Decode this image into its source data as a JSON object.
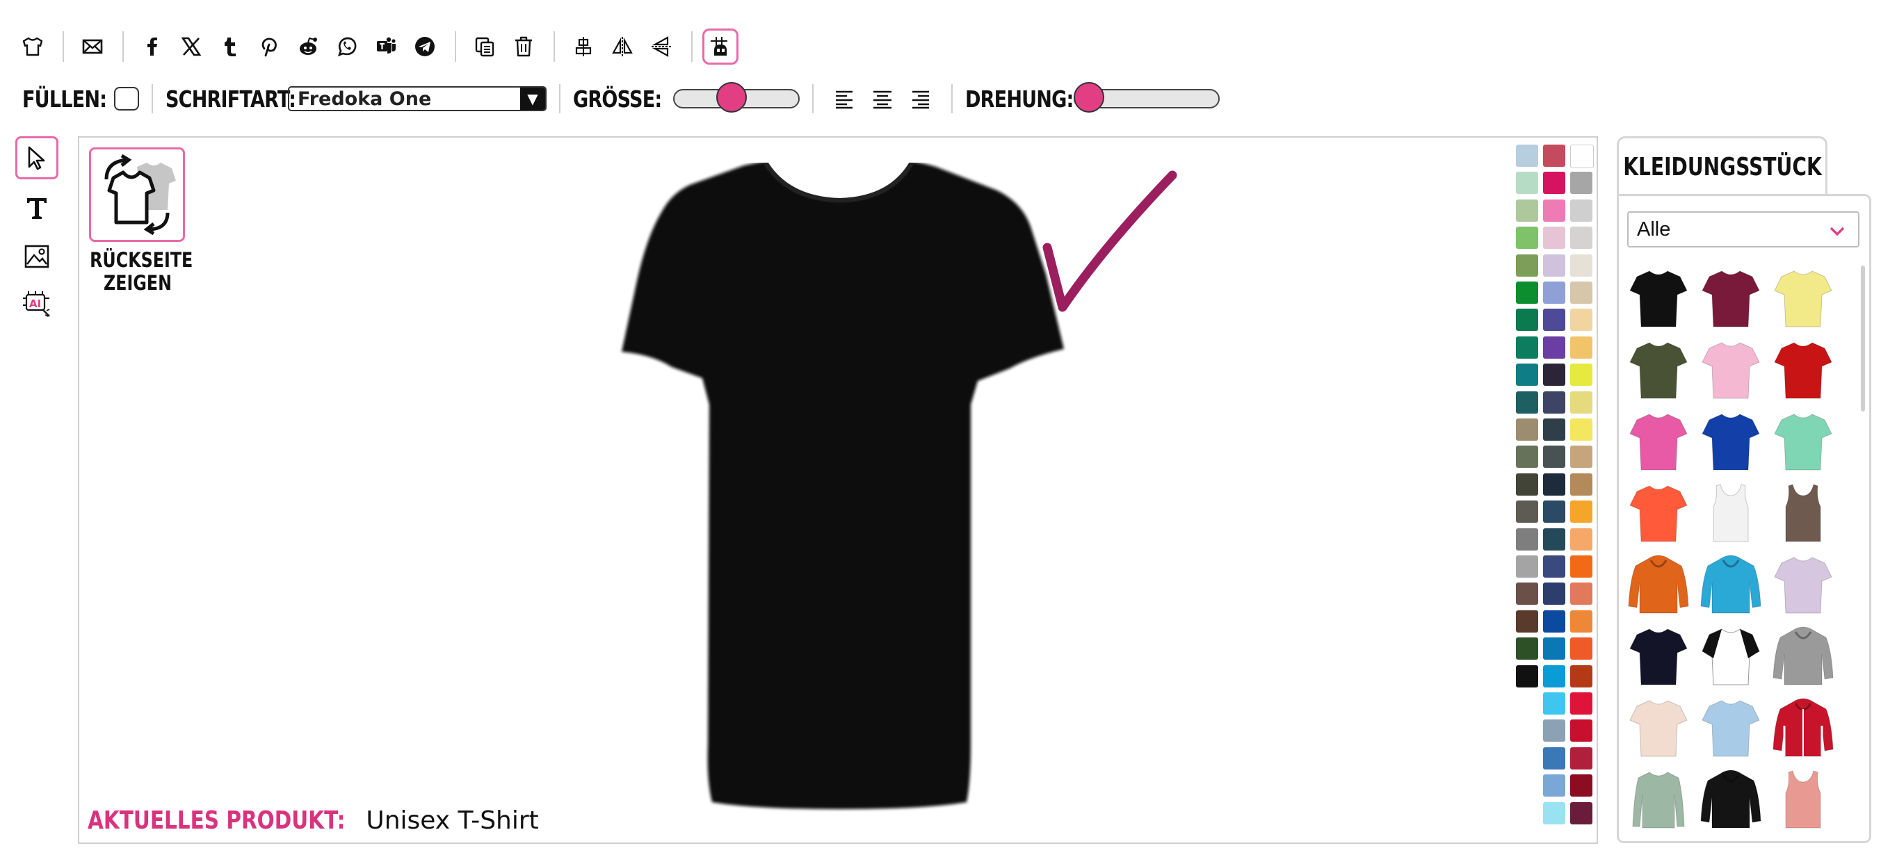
{
  "toolbar": {
    "icons": [
      "tshirt-icon",
      "mail-icon",
      "facebook-icon",
      "x-icon",
      "tumblr-icon",
      "pinterest-icon",
      "reddit-icon",
      "whatsapp-icon",
      "teams-icon",
      "telegram-icon",
      "duplicate-icon",
      "trash-icon",
      "center-icon",
      "flip-horizontal-icon",
      "flip-vertical-icon",
      "grid-icon"
    ]
  },
  "format": {
    "fill_label": "FÜLLEN:",
    "font_label": "SCHRIFTART:",
    "font_value": "Fredoka One",
    "size_label": "GRÖSSE:",
    "size_level": 0.45,
    "rotation_label": "DREHUNG:",
    "rotation_level": 0.0
  },
  "tools": [
    "select-tool",
    "text-tool",
    "image-tool",
    "ai-tool"
  ],
  "canvas": {
    "back_label_1": "RÜCKSEITE",
    "back_label_2": "ZEIGEN",
    "product_key": "AKTUELLES PRODUKT:",
    "product_value": "Unisex T-Shirt"
  },
  "palette": [
    [
      "#b6cedd",
      "#c34b5d",
      "#ffffff"
    ],
    [
      "#b6dcc6",
      "#d6135f",
      "#a6a6a6"
    ],
    [
      "#adc89a",
      "#ee7bb3",
      "#cfcfcf"
    ],
    [
      "#7fc26a",
      "#e6c4d6",
      "#d6d2d2"
    ],
    [
      "#7c9e58",
      "#d0c2dc",
      "#e6e0d6"
    ],
    [
      "#0c8d2e",
      "#8fa0d6",
      "#d6c6aa"
    ],
    [
      "#0b7a4e",
      "#4e4a98",
      "#f2d4a0"
    ],
    [
      "#0d7d60",
      "#6b3ea3",
      "#f2c46a"
    ],
    [
      "#0e7d85",
      "#2c2538",
      "#e6ea3e"
    ],
    [
      "#1e5f62",
      "#3e4466",
      "#e6da7e"
    ],
    [
      "#9c8c70",
      "#2f3f4a",
      "#f5e660"
    ],
    [
      "#66735a",
      "#485252",
      "#c6a57c"
    ],
    [
      "#414436",
      "#1e2b3a",
      "#b48a5a"
    ],
    [
      "#5e5b52",
      "#2a4a66",
      "#f5a62a"
    ],
    [
      "#7e7e7e",
      "#244a5a",
      "#f5a868"
    ],
    [
      "#a4a4a4",
      "#3b4a7e",
      "#f26a16"
    ],
    [
      "#6b5048",
      "#2c3e6e",
      "#e07a5a"
    ],
    [
      "#5a3a2a",
      "#0c4aa0",
      "#ee8838"
    ],
    [
      "#2e5026",
      "#0a78b4",
      "#ee5a28"
    ],
    [
      "#111111",
      "#0a9cd6",
      "#b43a16"
    ],
    [
      null,
      "#3ec6ee",
      "#e0143a"
    ],
    [
      null,
      "#8aa2b4",
      "#c8102e"
    ],
    [
      null,
      "#3a78b6",
      "#b0203a"
    ],
    [
      null,
      "#7aa8d6",
      "#8c0c22"
    ],
    [
      null,
      "#98e2f2",
      "#6a1c3a"
    ]
  ],
  "panel": {
    "tab_label": "KLEIDUNGSSTÜCK",
    "category_value": "Alle",
    "items": [
      {
        "type": "tee",
        "color": "#111111"
      },
      {
        "type": "tee",
        "color": "#7a1a3a"
      },
      {
        "type": "tee",
        "color": "#f2ea88"
      },
      {
        "type": "tee",
        "color": "#4a5236"
      },
      {
        "type": "tee",
        "color": "#f4b8d2"
      },
      {
        "type": "tee",
        "color": "#c81414"
      },
      {
        "type": "tee",
        "color": "#e85aa6"
      },
      {
        "type": "tee",
        "color": "#1240a8"
      },
      {
        "type": "tee",
        "color": "#7ed6b4"
      },
      {
        "type": "tee",
        "color": "#ff5a3a"
      },
      {
        "type": "tank",
        "color": "#f2f2f2"
      },
      {
        "type": "tank",
        "color": "#6e5a4e"
      },
      {
        "type": "hoodie",
        "color": "#e0641a"
      },
      {
        "type": "hoodie",
        "color": "#2aa8d6"
      },
      {
        "type": "tee",
        "color": "#d6c6e0"
      },
      {
        "type": "tee",
        "color": "#141428"
      },
      {
        "type": "raglan",
        "color": "#ffffff"
      },
      {
        "type": "hoodie",
        "color": "#9a9a9a"
      },
      {
        "type": "tee",
        "color": "#f2dcd0"
      },
      {
        "type": "tee",
        "color": "#a8cce8"
      },
      {
        "type": "jacket",
        "color": "#c8142a"
      },
      {
        "type": "longsleeve",
        "color": "#9cb8a4"
      },
      {
        "type": "hoodie",
        "color": "#141414"
      },
      {
        "type": "tank",
        "color": "#e89a92"
      }
    ]
  },
  "accent_color": "#e23e84"
}
